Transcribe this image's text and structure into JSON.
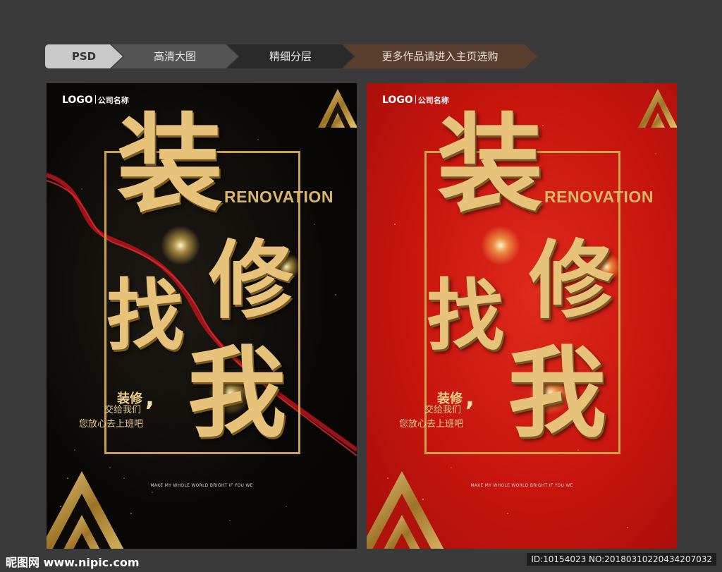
{
  "steps": [
    "PSD",
    "高清大图",
    "精细分层",
    "更多作品请进入主页选购"
  ],
  "posters": [
    {
      "logo": "LOGO",
      "company": "公司名称",
      "big_chars": [
        "装",
        "修",
        "找",
        "我"
      ],
      "english": "RENOVATION",
      "tagline_1": "装修",
      "tagline_2": "交给我们",
      "tagline_3": "您放心去上班吧",
      "slogan": "MAKE MY WHOLE WORLD BRIGHT IF YOU WE"
    },
    {
      "logo": "LOGO",
      "company": "公司名称",
      "big_chars": [
        "装",
        "修",
        "找",
        "我"
      ],
      "english": "RENOVATION",
      "tagline_1": "装修",
      "tagline_2": "交给我们",
      "tagline_3": "您放心去上班吧",
      "slogan": "MAKE MY WHOLE WORLD BRIGHT IF YOU WE"
    }
  ],
  "watermark": {
    "site": "昵图网 www.nipic.com",
    "id_text": "ID:10154023 NO:20180310220434207032"
  },
  "colors": {
    "gold": "#d9b76a",
    "black_bg": "#0a0806",
    "red_bg": "#c7150e"
  }
}
